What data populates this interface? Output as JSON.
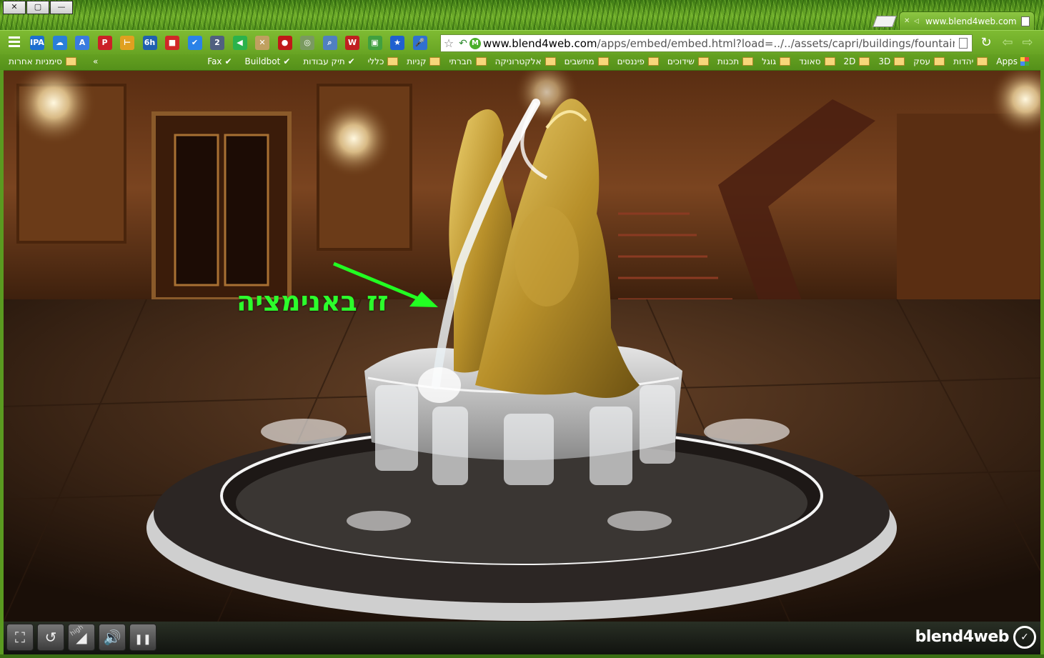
{
  "window": {
    "controls": [
      "✕",
      "▢",
      "—"
    ]
  },
  "tab": {
    "title": "www.blend4web.com"
  },
  "toolbar": {
    "extensions": [
      {
        "icon": "ipa-icon",
        "label": "IPA",
        "color": "#1e6fd0"
      },
      {
        "icon": "cloud-icon",
        "label": "☁",
        "color": "#2a7fd8"
      },
      {
        "icon": "translate-icon",
        "label": "A",
        "color": "#3a7be0"
      },
      {
        "icon": "pinterest-icon",
        "label": "P",
        "color": "#cb2027"
      },
      {
        "icon": "hebrew-tool-icon",
        "label": "⊢",
        "color": "#e0a020"
      },
      {
        "icon": "calendar-icon",
        "label": "6h",
        "color": "#2060b0"
      },
      {
        "icon": "bookmark-red-icon",
        "label": "■",
        "color": "#d02828"
      },
      {
        "icon": "check-icon",
        "label": "✔",
        "color": "#2a82e8"
      },
      {
        "icon": "counter-icon",
        "label": "2",
        "color": "#506080"
      },
      {
        "icon": "feedly-icon",
        "label": "◀",
        "color": "#2bb24c"
      },
      {
        "icon": "map-icon",
        "label": "✕",
        "color": "#c0a060"
      },
      {
        "icon": "stop-icon",
        "label": "●",
        "color": "#c01818"
      },
      {
        "icon": "chrome-icon",
        "label": "◎",
        "color": "#7a9a60"
      },
      {
        "icon": "search-magnifier-icon",
        "label": "⌕",
        "color": "#5080c0"
      },
      {
        "icon": "office-icon",
        "label": "W",
        "color": "#c02020"
      },
      {
        "icon": "screenshot-icon",
        "label": "▣",
        "color": "#40a040"
      },
      {
        "icon": "star-bookmark-icon",
        "label": "★",
        "color": "#2060d0"
      },
      {
        "icon": "microphone-icon",
        "label": "🎤",
        "color": "#3070d0"
      }
    ],
    "omnibox": {
      "host": "www.blend4web.com",
      "path": "/apps/embed/embed.html?load=../../assets/capri/buildings/fountain_e"
    }
  },
  "bookmarks": {
    "items": [
      {
        "label": "Apps",
        "kind": "apps"
      },
      {
        "label": "יהדות",
        "kind": "folder"
      },
      {
        "label": "עסק",
        "kind": "folder"
      },
      {
        "label": "3D",
        "kind": "folder"
      },
      {
        "label": "2D",
        "kind": "folder"
      },
      {
        "label": "סאונד",
        "kind": "folder"
      },
      {
        "label": "גוגל",
        "kind": "folder"
      },
      {
        "label": "תכנות",
        "kind": "folder"
      },
      {
        "label": "שידוכים",
        "kind": "folder"
      },
      {
        "label": "פיננסים",
        "kind": "folder"
      },
      {
        "label": "מחשבים",
        "kind": "folder"
      },
      {
        "label": "אלקטרוניקה",
        "kind": "folder"
      },
      {
        "label": "חברתי",
        "kind": "folder"
      },
      {
        "label": "קניות",
        "kind": "folder"
      },
      {
        "label": "כללי",
        "kind": "folder"
      },
      {
        "label": "תיק עבודות",
        "kind": "site"
      },
      {
        "label": "Buildbot",
        "kind": "site"
      },
      {
        "label": "Fax",
        "kind": "site"
      }
    ],
    "overflow": "»",
    "other": "סימניות אחרות"
  },
  "scene": {
    "annotation": "זז באנימציה",
    "arrow_color": "#22ff22"
  },
  "player": {
    "buttons": [
      {
        "name": "fullscreen-button",
        "icon": "fullscreen-icon",
        "glyph": "⛶"
      },
      {
        "name": "rotate-button",
        "icon": "rotate-camera-icon",
        "glyph": "↺"
      },
      {
        "name": "quality-button",
        "icon": "quality-high-icon",
        "glyph": "◢"
      },
      {
        "name": "sound-button",
        "icon": "speaker-icon",
        "glyph": "🔊"
      },
      {
        "name": "pause-button",
        "icon": "pause-icon",
        "glyph": "❚❚"
      }
    ],
    "quality_label": "high",
    "brand": "blend4web"
  }
}
